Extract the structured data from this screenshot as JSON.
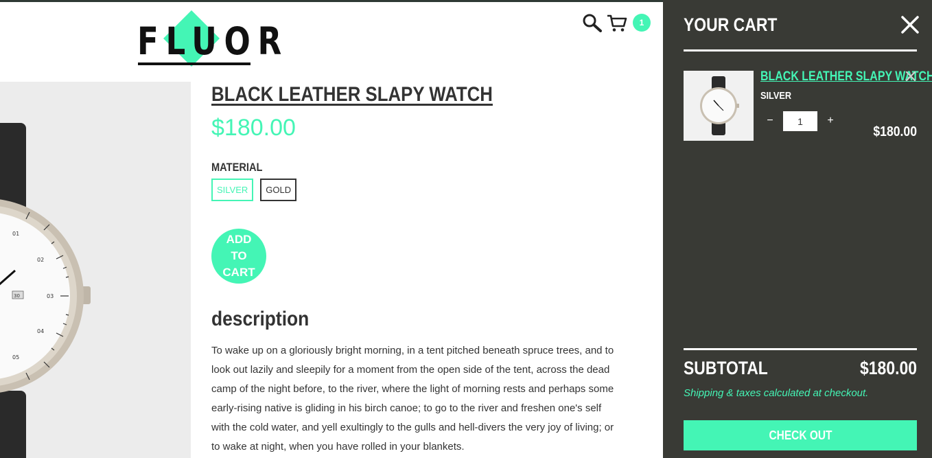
{
  "brand": {
    "logo_text": "FLUOR"
  },
  "header": {
    "cart_count": "1"
  },
  "product": {
    "title": "BLACK LEATHER SLAPY WATCH",
    "price": "$180.00",
    "option_label": "MATERIAL",
    "options": [
      {
        "label": "SILVER",
        "selected": true
      },
      {
        "label": "GOLD",
        "selected": false
      }
    ],
    "add_to_cart": "ADD TO CART",
    "description_heading": "description",
    "description": "To wake up on a gloriously bright morning, in a tent pitched beneath spruce trees, and to look out lazily and sleepily for a moment from the open side of the tent, across the dead camp of the night before, to the river, where the light of morning rests and perhaps some early-rising native is gliding in his birch canoe; to go to the river and freshen one's self with the cold water, and yell exultingly to the gulls and hell-divers the very joy of living; or to wake at night, when you have rolled in your blankets.",
    "dial_numbers": [
      "01",
      "02",
      "03",
      "04",
      "05"
    ],
    "date_window": "30"
  },
  "cart": {
    "title": "YOUR CART",
    "items": [
      {
        "title": "BLACK LEATHER SLAPY WATCH",
        "variant": "SILVER",
        "quantity": "1",
        "decrement": "−",
        "increment": "+",
        "price": "$180.00"
      }
    ],
    "subtotal_label": "SUBTOTAL",
    "subtotal_value": "$180.00",
    "shipping_note": "Shipping & taxes calculated at checkout.",
    "checkout_label": "CHECK OUT"
  },
  "colors": {
    "accent": "#44f5b5",
    "drawer_bg": "#393a35",
    "text_dark": "#333333"
  },
  "icons": [
    "search-icon",
    "cart-icon",
    "close-icon",
    "remove-icon"
  ]
}
